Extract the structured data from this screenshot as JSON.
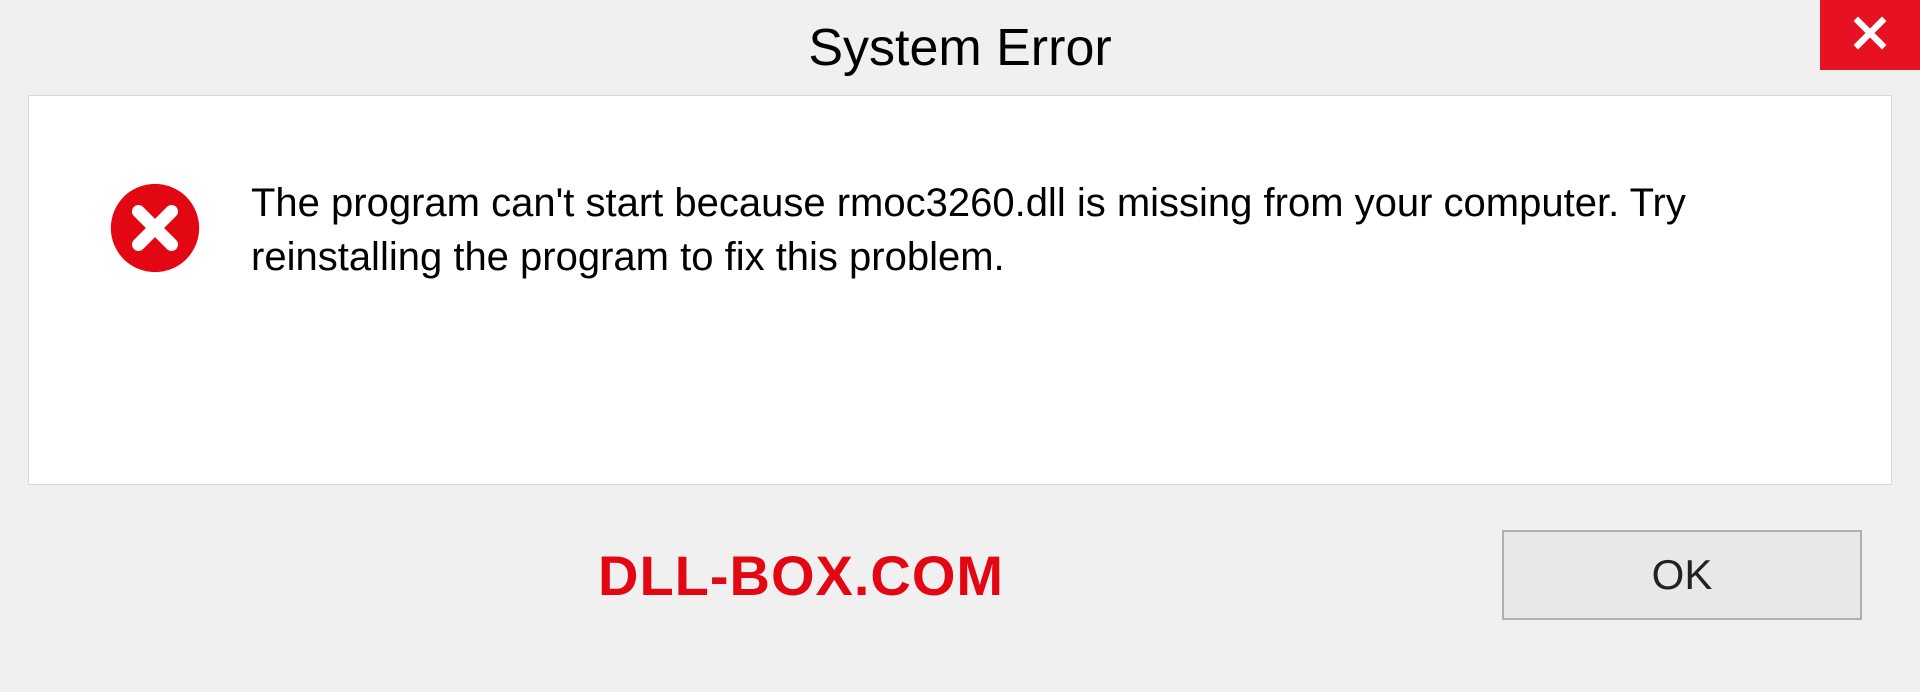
{
  "titlebar": {
    "title": "System Error"
  },
  "dialog": {
    "message": "The program can't start because rmoc3260.dll is missing from your computer. Try reinstalling the program to fix this problem."
  },
  "footer": {
    "watermark": "DLL-BOX.COM",
    "ok_label": "OK"
  },
  "colors": {
    "close_bg": "#e81123",
    "error_red": "#e30613",
    "panel_bg": "#ffffff",
    "body_bg": "#f0f0f0"
  }
}
